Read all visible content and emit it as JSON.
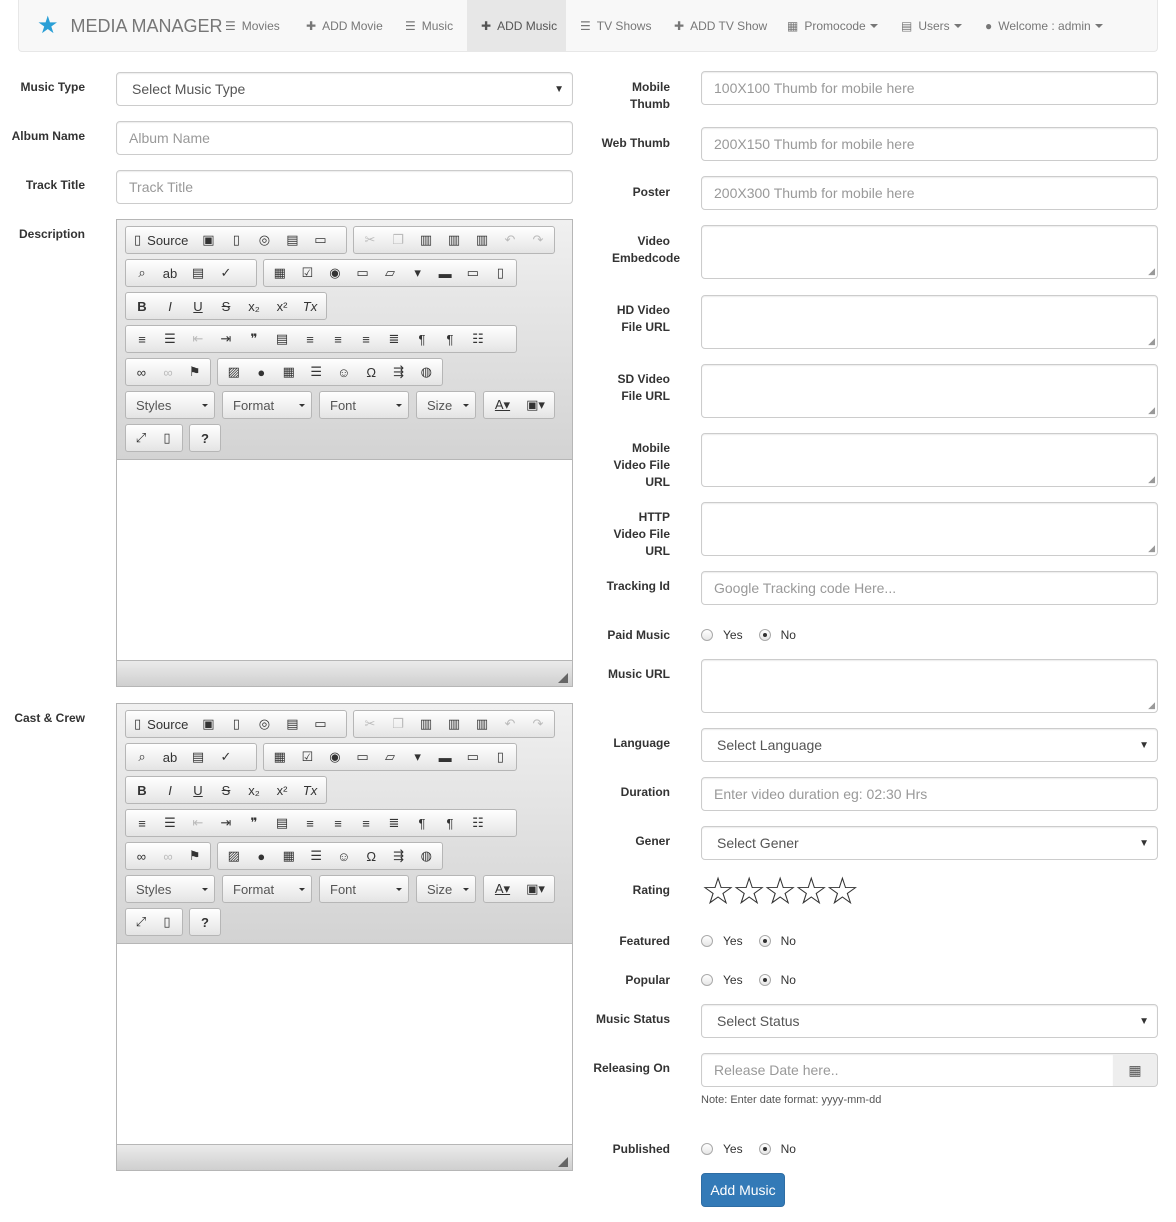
{
  "nav": {
    "brand": "MEDIA MANAGER",
    "items": [
      {
        "label": "Movies",
        "icon": "list-icon"
      },
      {
        "label": "ADD Movie",
        "icon": "plus-icon"
      },
      {
        "label": "Music",
        "icon": "list-icon"
      },
      {
        "label": "ADD Music",
        "icon": "plus-icon"
      },
      {
        "label": "TV Shows",
        "icon": "list-icon"
      },
      {
        "label": "ADD TV Show",
        "icon": "plus-icon"
      },
      {
        "label": "Promocode",
        "icon": "gift-icon"
      },
      {
        "label": "Users",
        "icon": "book-icon"
      },
      {
        "label": "Welcome : admin",
        "icon": "user-icon"
      }
    ],
    "active_item": "ADD Music"
  },
  "left": {
    "music_type": {
      "label": "Music Type",
      "value": "Select Music Type"
    },
    "album_name": {
      "label": "Album Name",
      "placeholder": "Album Name"
    },
    "track_title": {
      "label": "Track Title",
      "placeholder": "Track Title"
    },
    "description": {
      "label": "Description"
    },
    "cast_crew": {
      "label": "Cast & Crew"
    }
  },
  "editor": {
    "source": "Source",
    "styles": "Styles",
    "format": "Format",
    "font": "Font",
    "size": "Size"
  },
  "right": {
    "mobile_thumb": {
      "label": "Mobile Thumb",
      "placeholder": "100X100 Thumb for mobile here"
    },
    "web_thumb": {
      "label": "Web Thumb",
      "placeholder": "200X150 Thumb for mobile here"
    },
    "poster": {
      "label": "Poster",
      "placeholder": "200X300 Thumb for mobile here"
    },
    "video_embedcode": {
      "label": "Video Embedcode"
    },
    "hd_video": {
      "label": "HD Video File URL"
    },
    "sd_video": {
      "label": "SD Video File URL"
    },
    "mobile_video": {
      "label": "Mobile Video File URL"
    },
    "http_video": {
      "label": "HTTP Video File URL"
    },
    "tracking_id": {
      "label": "Tracking Id",
      "placeholder": "Google Tracking code Here..."
    },
    "paid_music": {
      "label": "Paid Music",
      "yes": "Yes",
      "no": "No",
      "selected": "No"
    },
    "music_url": {
      "label": "Music URL"
    },
    "language": {
      "label": "Language",
      "value": "Select Language"
    },
    "duration": {
      "label": "Duration",
      "placeholder": "Enter video duration eg: 02:30 Hrs"
    },
    "gener": {
      "label": "Gener",
      "value": "Select Gener"
    },
    "rating": {
      "label": "Rating",
      "stars": 5,
      "filled": 0
    },
    "featured": {
      "label": "Featured",
      "yes": "Yes",
      "no": "No",
      "selected": "No"
    },
    "popular": {
      "label": "Popular",
      "yes": "Yes",
      "no": "No",
      "selected": "No"
    },
    "music_status": {
      "label": "Music Status",
      "value": "Select Status"
    },
    "releasing_on": {
      "label": "Releasing On",
      "placeholder": "Release Date here..",
      "note": "Note: Enter date format: yyyy-mm-dd"
    },
    "published": {
      "label": "Published",
      "yes": "Yes",
      "no": "No",
      "selected": "No"
    },
    "submit": "Add Music"
  },
  "colors": {
    "primary": "#337ab7",
    "brand_star": "#2a9fd6",
    "nav_bg": "#f8f8f8"
  }
}
